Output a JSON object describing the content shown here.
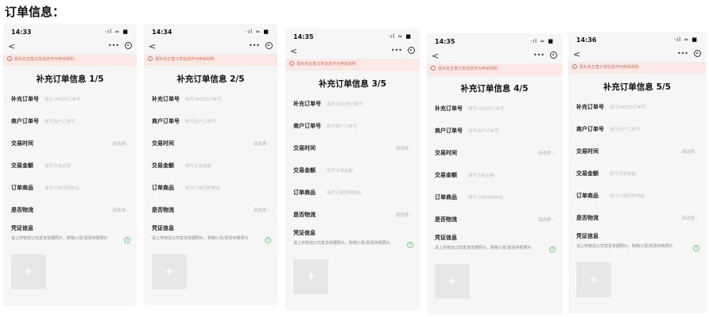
{
  "heading": "订单信息：",
  "notice_text": "需补充五笔订单信息作为申诉材料",
  "system_status": "·ıl ≈ ■",
  "nav": {
    "back": "<",
    "more": "•••"
  },
  "labels": {
    "order_no": "补充订单号",
    "merchant_no": "商户订单号",
    "time": "交易时间",
    "amount": "交易金额",
    "goods": "订单商品",
    "logistics": "是否物流",
    "proof": "凭证信息"
  },
  "placeholders": {
    "order_no": "填写28位的订单号",
    "merchant_no": "填写商户订单号",
    "amount": "填写交易金额",
    "goods": "填写订单所购物品",
    "select": "请选择 ›"
  },
  "proof_desc": "请上传物流公司发货单据照片，购物小票/发票存根照片",
  "upload_plus": "+",
  "info_icon": "i",
  "screens": [
    {
      "time": "14:33",
      "title": "补充订单信息 1/5"
    },
    {
      "time": "14:34",
      "title": "补充订单信息 2/5"
    },
    {
      "time": "14:35",
      "title": "补充订单信息 3/5"
    },
    {
      "time": "14:35",
      "title": "补充订单信息 4/5"
    },
    {
      "time": "14:36",
      "title": "补充订单信息 5/5"
    }
  ]
}
